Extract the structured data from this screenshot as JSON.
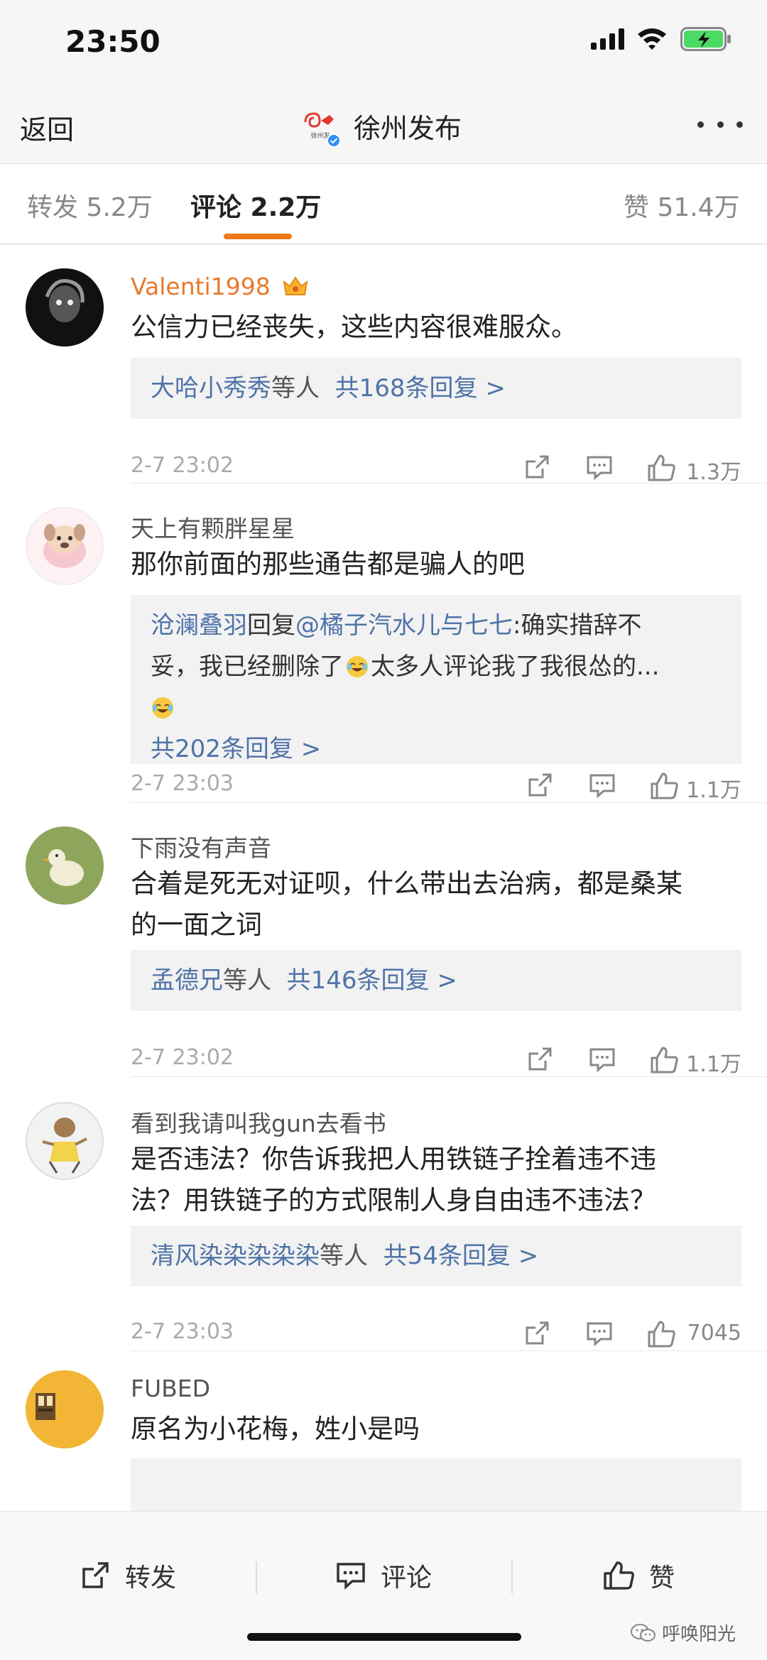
{
  "status_bar": {
    "time": "23:50"
  },
  "nav": {
    "back": "返回",
    "title": "徐州发布",
    "logo_caption": "徐州发"
  },
  "tabs": {
    "repost": "转发 5.2万",
    "comment": "评论 2.2万",
    "like": "赞 51.4万"
  },
  "comments": [
    {
      "user": "Valenti1998",
      "text": "公信力已经丧失，这些内容很难服众。",
      "reply_names": "大哈小秀秀",
      "reply_suffix": "等人",
      "reply_count": "共168条回复 >",
      "date": "2-7 23:02",
      "likes": "1.3万"
    },
    {
      "user": "天上有颗胖星星",
      "text": "那你前面的那些通告都是骗人的吧",
      "reply_from": "沧澜叠羽",
      "reply_verb": "回复",
      "reply_to": "@橘子汽水儿与七七",
      "reply_text_1": ":确实措辞不",
      "reply_text_2": "妥，我已经删除了",
      "reply_text_3": "太多人评论我了我很怂的...",
      "reply_count": "共202条回复 >",
      "date": "2-7 23:03",
      "likes": "1.1万"
    },
    {
      "user": "下雨没有声音",
      "text_1": "合着是死无对证呗，什么带出去治病，都是桑某",
      "text_2": "的一面之词",
      "reply_names": "孟德兄",
      "reply_suffix": "等人",
      "reply_count": "共146条回复 >",
      "date": "2-7 23:02",
      "likes": "1.1万"
    },
    {
      "user": "看到我请叫我gun去看书",
      "text_1": "是否违法？你告诉我把人用铁链子拴着违不违",
      "text_2": "法？用铁链子的方式限制人身自由违不违法？",
      "reply_names": "清风染染染染染",
      "reply_suffix": "等人",
      "reply_count": "共54条回复 >",
      "date": "2-7 23:03",
      "likes": "7045"
    },
    {
      "user": "FUBED",
      "text": "原名为小花梅，姓小是吗"
    }
  ],
  "bottom_bar": {
    "repost": "转发",
    "comment": "评论",
    "like": "赞"
  },
  "watermark": "呼唤阳光"
}
